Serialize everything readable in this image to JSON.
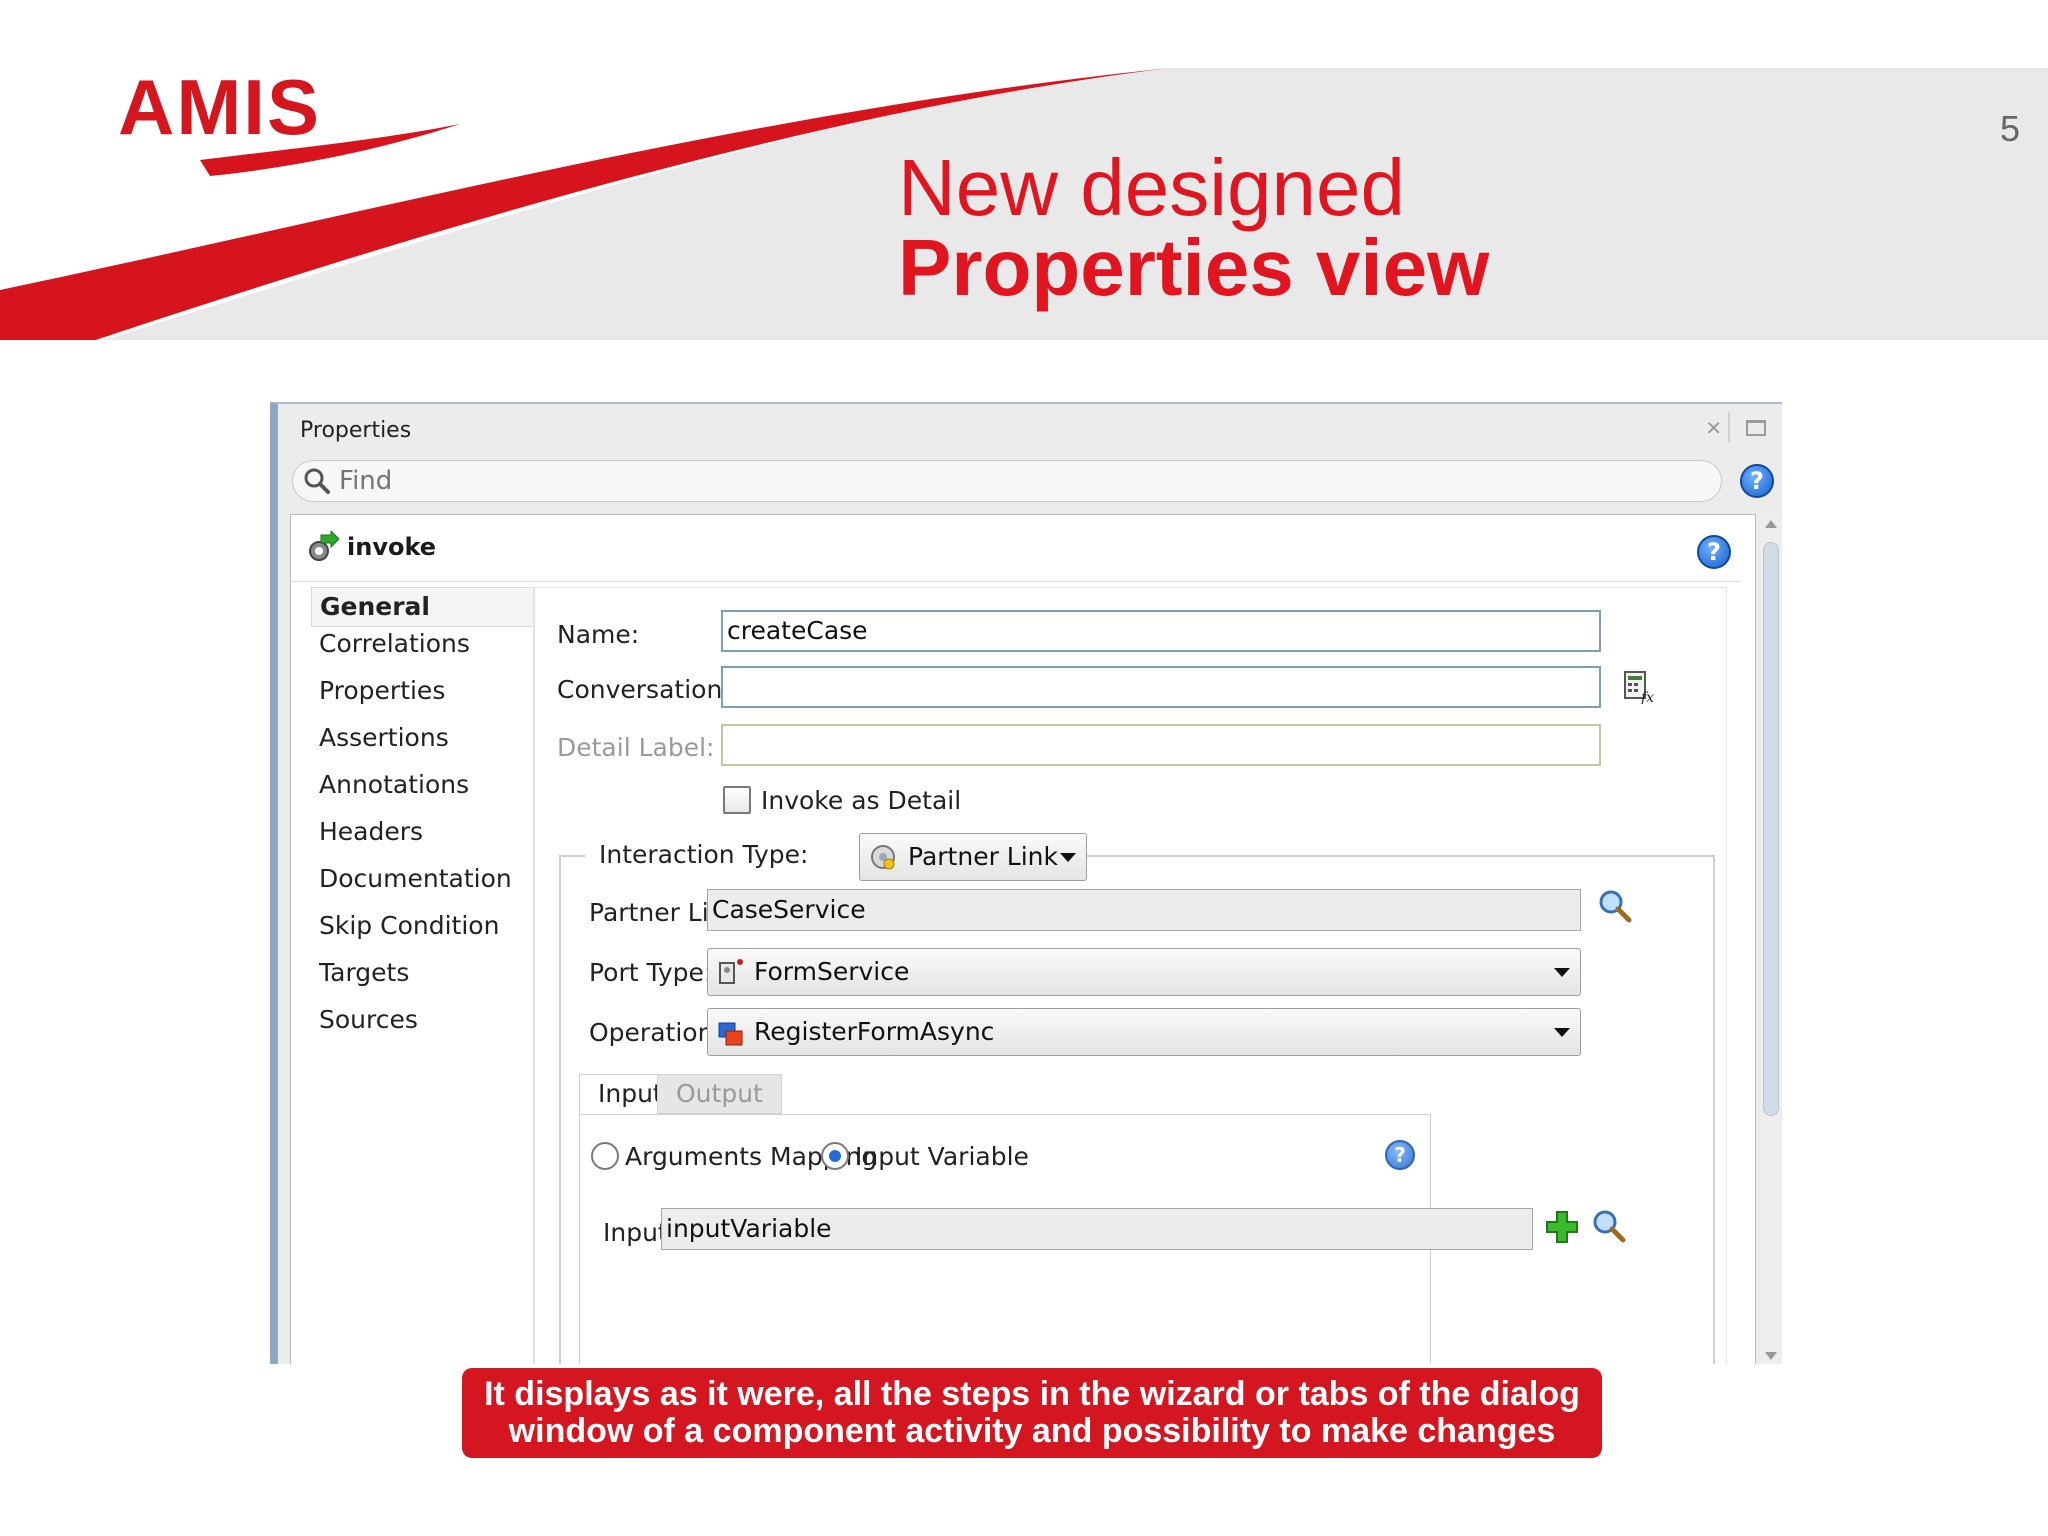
{
  "slide": {
    "logo_text": "AMIS",
    "page_number": "5",
    "title_line1": "New designed",
    "title_line2": "Properties view",
    "callout_line1": "It displays as it were, all the steps in the wizard or tabs of the dialog",
    "callout_line2": "window of a component activity and possibility to make changes",
    "accent_color": "#d4161f"
  },
  "window": {
    "title": "Properties",
    "find_placeholder": "Find",
    "help_label": "?",
    "activity_name": "invoke",
    "nav_items": [
      "General",
      "Correlations",
      "Properties",
      "Assertions",
      "Annotations",
      "Headers",
      "Documentation",
      "Skip Condition",
      "Targets",
      "Sources"
    ],
    "form": {
      "name_label": "Name:",
      "name_value": "createCase",
      "conversation_label": "Conversation ID:",
      "conversation_value": "",
      "detail_label": "Detail Label:",
      "detail_value": "",
      "invoke_detail_label": "Invoke as Detail",
      "interaction_label": "Interaction Type:",
      "interaction_value": "Partner Link",
      "partner_link_label": "Partner Link:",
      "partner_link_value": "CaseService",
      "port_type_label": "Port Type:",
      "port_type_value": "FormService",
      "operation_label": "Operation:",
      "operation_value": "RegisterFormAsync",
      "tab_input": "Input",
      "tab_output": "Output",
      "radio_arguments": "Arguments Mapping",
      "radio_input_variable": "Input Variable",
      "input_label": "Input:",
      "input_value": "inputVariable"
    }
  }
}
